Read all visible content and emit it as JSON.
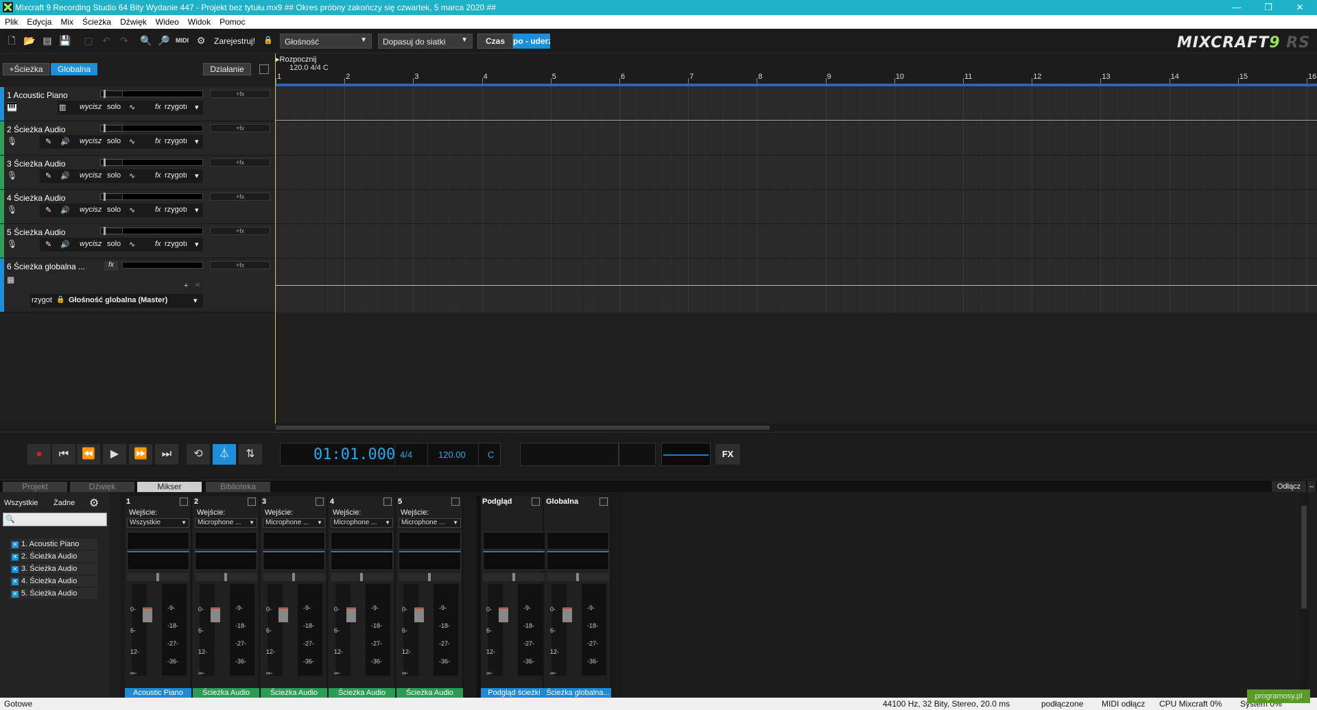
{
  "window": {
    "title": "Mixcraft 9 Recording Studio 64 Bity Wydanie 447 - Projekt bez tytułu.mx9  ## Okres próbny zakończy się czwartek, 5 marca 2020 ##",
    "min": "—",
    "max": "❐",
    "close": "✕"
  },
  "menu": [
    "Plik",
    "Edycja",
    "Mix",
    "Ścieżka",
    "Dźwięk",
    "Wideo",
    "Widok",
    "Pomoc"
  ],
  "toolbar": {
    "register_label": "Zarejestruj!",
    "volume_dropdown": "Głośność",
    "grid_dropdown": "Dopasuj do siatki",
    "time_label": "Czas",
    "tempo_label": "po - uderz",
    "logo_main": "MIXCRAFT",
    "logo_num": "9",
    "logo_suffix": "RS"
  },
  "trackheader": {
    "add_track": "+Ścieżka",
    "global": "Globalna",
    "action": "Działanie"
  },
  "ruler": {
    "start_label": "Rozpocznij",
    "tempo_info": "120.0 4/4 C",
    "bars": [
      "1",
      "2",
      "3",
      "4",
      "5",
      "6",
      "7",
      "8",
      "9",
      "10",
      "11",
      "12",
      "13",
      "14",
      "15",
      "16"
    ]
  },
  "tracks": [
    {
      "name": "1 Acoustic Piano",
      "fx": "+fx",
      "mute": "wycisz",
      "solo": "solo",
      "fx2": "fx",
      "arm": "rzygotı"
    },
    {
      "name": "2 Ścieżka Audio",
      "fx": "+fx",
      "mute": "wycisz",
      "solo": "solo",
      "fx2": "fx",
      "arm": "rzygotı"
    },
    {
      "name": "3 Ścieżka Audio",
      "fx": "+fx",
      "mute": "wycisz",
      "solo": "solo",
      "fx2": "fx",
      "arm": "rzygotı"
    },
    {
      "name": "4 Ścieżka Audio",
      "fx": "+fx",
      "mute": "wycisz",
      "solo": "solo",
      "fx2": "fx",
      "arm": "rzygotı"
    },
    {
      "name": "5 Ścieżka Audio",
      "fx": "+fx",
      "mute": "wycisz",
      "solo": "solo",
      "fx2": "fx",
      "arm": "rzygotı"
    },
    {
      "name": "6 Ścieżka globalna ...",
      "fx": "+fx",
      "fx2": "fx",
      "arm": "rzygot",
      "param": "Głośność globalna (Master)"
    }
  ],
  "transport": {
    "time": "01:01.000",
    "signature": "4/4",
    "tempo": "120.00",
    "key": "C",
    "fx": "FX"
  },
  "tabs": [
    "Projekt",
    "Dźwięk",
    "Mikser",
    "Biblioteka"
  ],
  "detach": "Odłącz",
  "mixer_filter": {
    "all": "Wszystkie",
    "none": "Żadne",
    "items": [
      "1. Acoustic Piano",
      "2. Ścieżka Audio",
      "3. Ścieżka Audio",
      "4. Ścieżka Audio",
      "5. Ścieżka Audio"
    ]
  },
  "strips": [
    {
      "num": "1",
      "input_label": "Wejście:",
      "input": "Wszystkie",
      "name": "Acoustic Piano",
      "color": "blue"
    },
    {
      "num": "2",
      "input_label": "Wejście:",
      "input": "Microphone ...",
      "name": "Ścieżka Audio",
      "color": "green"
    },
    {
      "num": "3",
      "input_label": "Wejście:",
      "input": "Microphone ...",
      "name": "Ścieżka Audio",
      "color": "green"
    },
    {
      "num": "4",
      "input_label": "Wejście:",
      "input": "Microphone ...",
      "name": "Ścieżka Audio",
      "color": "green"
    },
    {
      "num": "5",
      "input_label": "Wejście:",
      "input": "Microphone ...",
      "name": "Ścieżka Audio",
      "color": "green"
    },
    {
      "num": "Podgląd",
      "name": "Podgląd ścieżki",
      "color": "blue"
    },
    {
      "num": "Globalna",
      "name": "Ścieżka globalna...",
      "color": "blue"
    }
  ],
  "fader_scale": [
    "0-",
    "6-",
    "12-",
    "∞-"
  ],
  "meter_scale": [
    "-9-",
    "-18-",
    "-27-",
    "-36-"
  ],
  "status": {
    "ready": "Gotowe",
    "audio": "44100 Hz, 32 Bity, Stereo, 20.0 ms",
    "connected": "podłączone",
    "midi": "MIDI odłącz",
    "cpu": "CPU Mixcraft 0%",
    "system": "System 0%",
    "badge": "programosy.pl"
  }
}
